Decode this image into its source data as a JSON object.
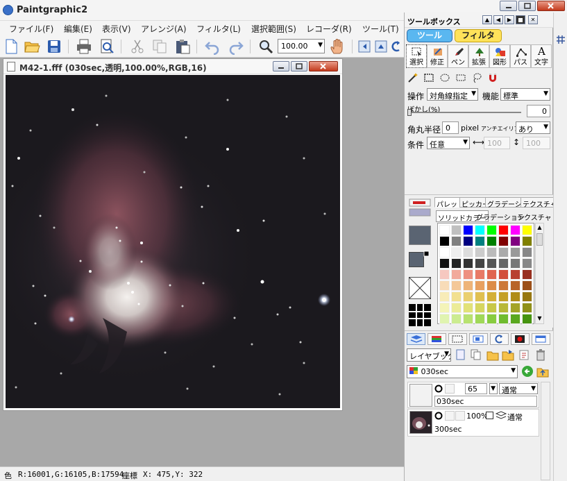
{
  "app": {
    "title": "Paintgraphic2"
  },
  "menu": [
    "ファイル(F)",
    "編集(E)",
    "表示(V)",
    "アレンジ(A)",
    "フィルタ(L)",
    "選択範囲(S)",
    "レコーダ(R)",
    "ツール(T)"
  ],
  "toolbar": {
    "zoom_value": "100.00"
  },
  "image_window": {
    "title": "M42-1.fff (030sec,透明,100.00%,RGB,16)"
  },
  "toolbox": {
    "title": "ツールボックス",
    "tab_tool": "ツール",
    "tab_filter": "フィルタ",
    "tools": [
      {
        "label": "選択",
        "icon": "select-icon"
      },
      {
        "label": "修正",
        "icon": "retouch-icon"
      },
      {
        "label": "ペン",
        "icon": "pen-icon"
      },
      {
        "label": "拡張",
        "icon": "tree-icon"
      },
      {
        "label": "図形",
        "icon": "shape-icon"
      },
      {
        "label": "パス",
        "icon": "path-icon"
      },
      {
        "label": "文字",
        "icon": "text-icon"
      }
    ],
    "text_tool_glyph": "A",
    "options": {
      "operation_label": "操作",
      "operation_value": "対角線指定",
      "function_label": "機能",
      "function_value": "標準",
      "blur_label": "ぼかし(%)",
      "blur_value": "0",
      "corner_label": "角丸半径",
      "corner_value": "0",
      "corner_unit": "pixel",
      "antialias_label": "アンチエイリアス",
      "antialias_value": "あり",
      "condition_label": "条件",
      "condition_value": "任意",
      "width_value": "100",
      "height_value": "100"
    }
  },
  "palette_panel": {
    "tabs": [
      "パレット",
      "ピッカー",
      "グラデーション",
      "テクスチャ"
    ],
    "subtabs": [
      "ソリッドカラー",
      "グラデーション",
      "テクスチャ"
    ],
    "swatch_colors": [
      "#ffffff",
      "#c0c0c0",
      "#0000ff",
      "#00ffff",
      "#00ff00",
      "#ff0000",
      "#ff00ff",
      "#ffff00",
      "#000000",
      "#808080",
      "#000080",
      "#008080",
      "#008000",
      "#800000",
      "#800080",
      "#808000",
      "#ffffff",
      "#eeeeee",
      "#dddddd",
      "#cccccc",
      "#bbbbbb",
      "#aaaaaa",
      "#999999",
      "#888888",
      "#111111",
      "#222222",
      "#333333",
      "#444444",
      "#555555",
      "#666666",
      "#777777",
      "#888888",
      "#f6c8c0",
      "#f2aa9c",
      "#ee9080",
      "#e87a66",
      "#e06650",
      "#d2503c",
      "#b84030",
      "#983020",
      "#f8dcb8",
      "#f4c898",
      "#eeb478",
      "#e8a060",
      "#dc8c48",
      "#cc7838",
      "#b86428",
      "#9c5018",
      "#f8ecb8",
      "#f2e090",
      "#ead070",
      "#e0c050",
      "#d4b038",
      "#c4a028",
      "#b08c18",
      "#987810",
      "#f4f4b8",
      "#ecec98",
      "#e2e278",
      "#d6d660",
      "#c8c848",
      "#b8b838",
      "#a4a428",
      "#909018",
      "#e0f4b0",
      "#ccec90",
      "#b8e270",
      "#a0d858",
      "#88cc40",
      "#70bc30",
      "#5aa820",
      "#469410"
    ]
  },
  "layer_panel": {
    "mode_value": "レイヤブック",
    "book_name": "030sec",
    "layers": [
      {
        "name": "030sec",
        "opacity": "65",
        "blend": "通常"
      },
      {
        "name": "300sec",
        "opacity": "100%",
        "blend": "通常"
      }
    ]
  },
  "status": {
    "color_label": "色",
    "color_value": "R:16001,G:16105,B:17594",
    "coord_label": "座標",
    "coord_value": "X: 475,Y: 322"
  }
}
